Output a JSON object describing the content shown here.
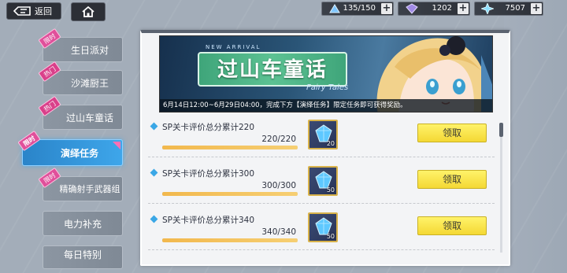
{
  "topbar": {
    "back_label": "返回",
    "resources": [
      {
        "icon": "fuel-icon",
        "value": "135/150"
      },
      {
        "icon": "crystal-icon",
        "value": "1202"
      },
      {
        "icon": "diamond-icon",
        "value": "7507"
      }
    ],
    "plus": "+"
  },
  "sidebar": {
    "tabs": [
      {
        "label": "生日派对",
        "tag": "限时"
      },
      {
        "label": "沙滩厨王",
        "tag": "热门"
      },
      {
        "label": "过山车童话",
        "tag": "热门"
      },
      {
        "label": "演绎任务",
        "tag": "限时",
        "active": true
      },
      {
        "label": "精确射手武器组",
        "tag": "限时"
      },
      {
        "label": "电力补充",
        "tag": ""
      },
      {
        "label": "每日特别",
        "tag": ""
      }
    ]
  },
  "banner": {
    "title": "过山车童话",
    "subtitle": "NEW ARRIVAL",
    "signature": "Fairy Tales",
    "notice": "6月14日12:00~6月29日04:00，完成下方【演绎任务】限定任务即可获得奖励。"
  },
  "tasks": [
    {
      "name": "SP关卡评价总分累计220",
      "progress": "220/220",
      "fraction": 1.0,
      "reward_count": "20",
      "button": "领取"
    },
    {
      "name": "SP关卡评价总分累计300",
      "progress": "300/300",
      "fraction": 1.0,
      "reward_count": "50",
      "button": "领取"
    },
    {
      "name": "SP关卡评价总分累计340",
      "progress": "340/340",
      "fraction": 1.0,
      "reward_count": "50",
      "button": "领取"
    }
  ],
  "colors": {
    "accent": "#3ea6ea",
    "claim": "#f4d834",
    "tag": "#e0509b",
    "progress": "#f2b84d"
  }
}
